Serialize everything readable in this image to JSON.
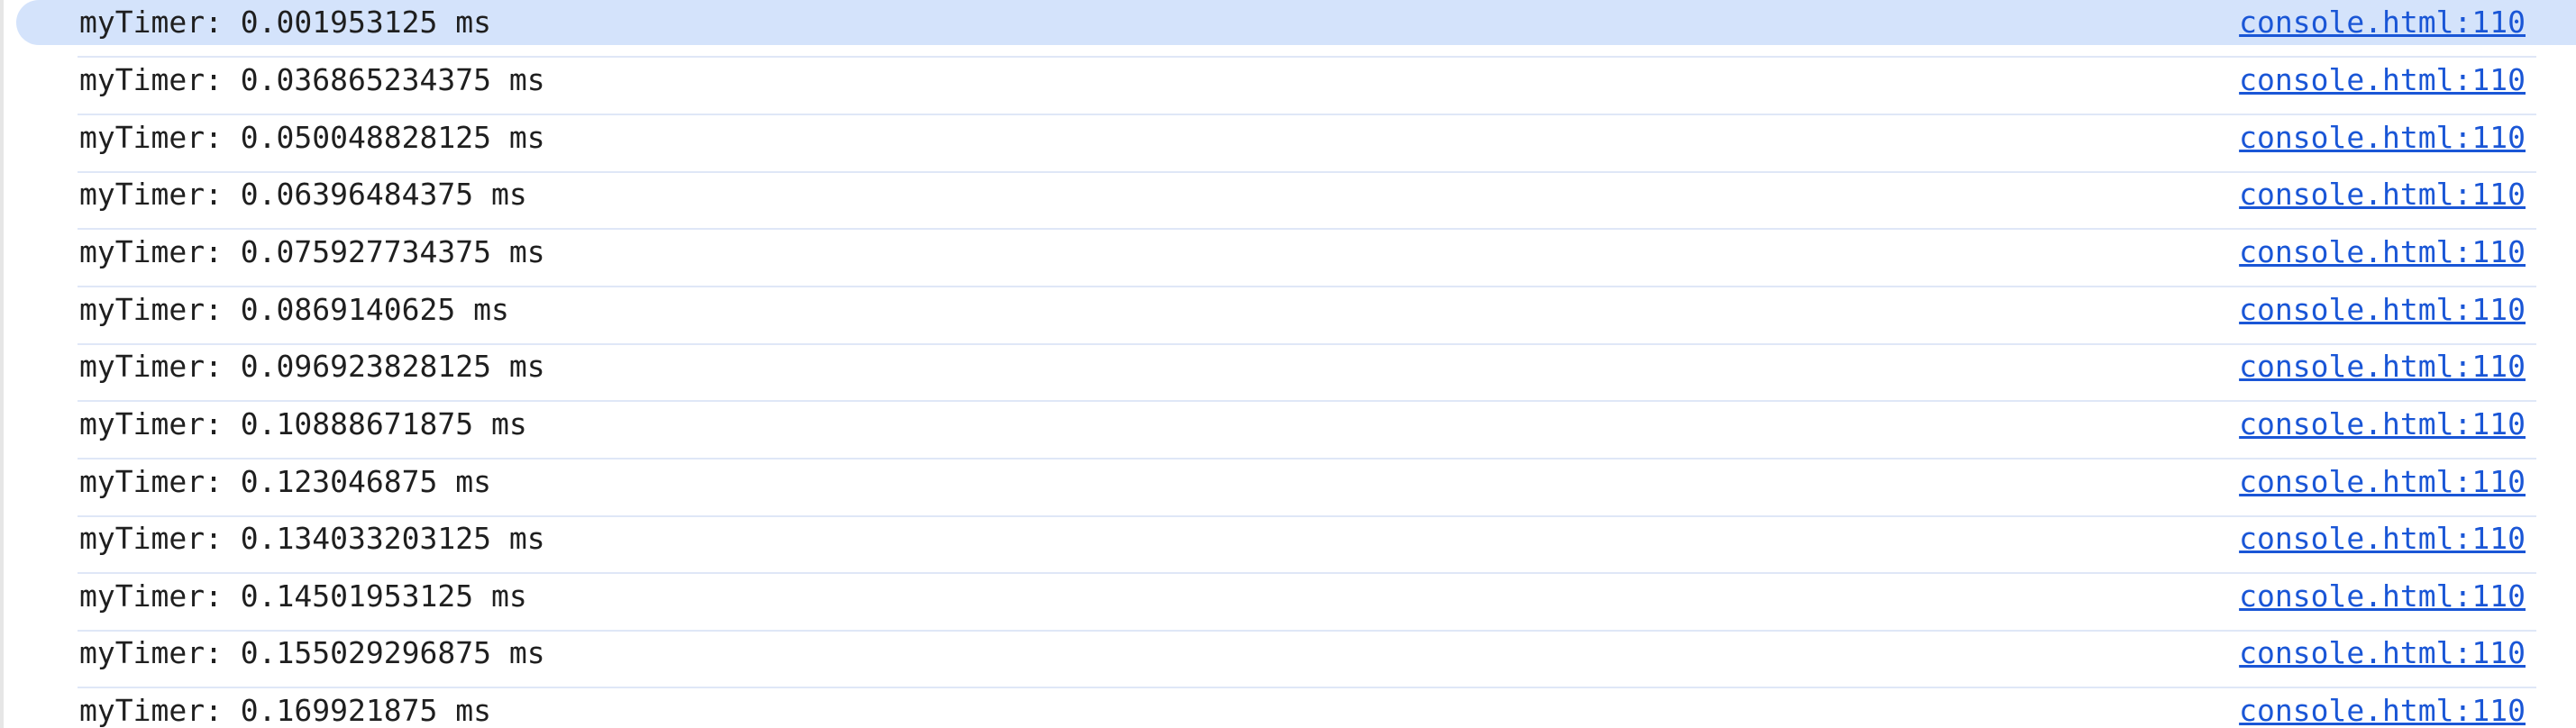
{
  "console": {
    "entries": [
      {
        "message": "myTimer: 0.001953125 ms",
        "source": "console.html:110"
      },
      {
        "message": "myTimer: 0.036865234375 ms",
        "source": "console.html:110"
      },
      {
        "message": "myTimer: 0.050048828125 ms",
        "source": "console.html:110"
      },
      {
        "message": "myTimer: 0.06396484375 ms",
        "source": "console.html:110"
      },
      {
        "message": "myTimer: 0.075927734375 ms",
        "source": "console.html:110"
      },
      {
        "message": "myTimer: 0.0869140625 ms",
        "source": "console.html:110"
      },
      {
        "message": "myTimer: 0.096923828125 ms",
        "source": "console.html:110"
      },
      {
        "message": "myTimer: 0.10888671875 ms",
        "source": "console.html:110"
      },
      {
        "message": "myTimer: 0.123046875 ms",
        "source": "console.html:110"
      },
      {
        "message": "myTimer: 0.134033203125 ms",
        "source": "console.html:110"
      },
      {
        "message": "myTimer: 0.14501953125 ms",
        "source": "console.html:110"
      },
      {
        "message": "myTimer: 0.155029296875 ms",
        "source": "console.html:110"
      },
      {
        "message": "myTimer: 0.169921875 ms",
        "source": "console.html:110"
      }
    ]
  },
  "colors": {
    "selected_row_bg": "#d4e3fb",
    "link": "#1a56d6",
    "text": "#1f1f1f",
    "row_divider": "#dfe7f7"
  }
}
